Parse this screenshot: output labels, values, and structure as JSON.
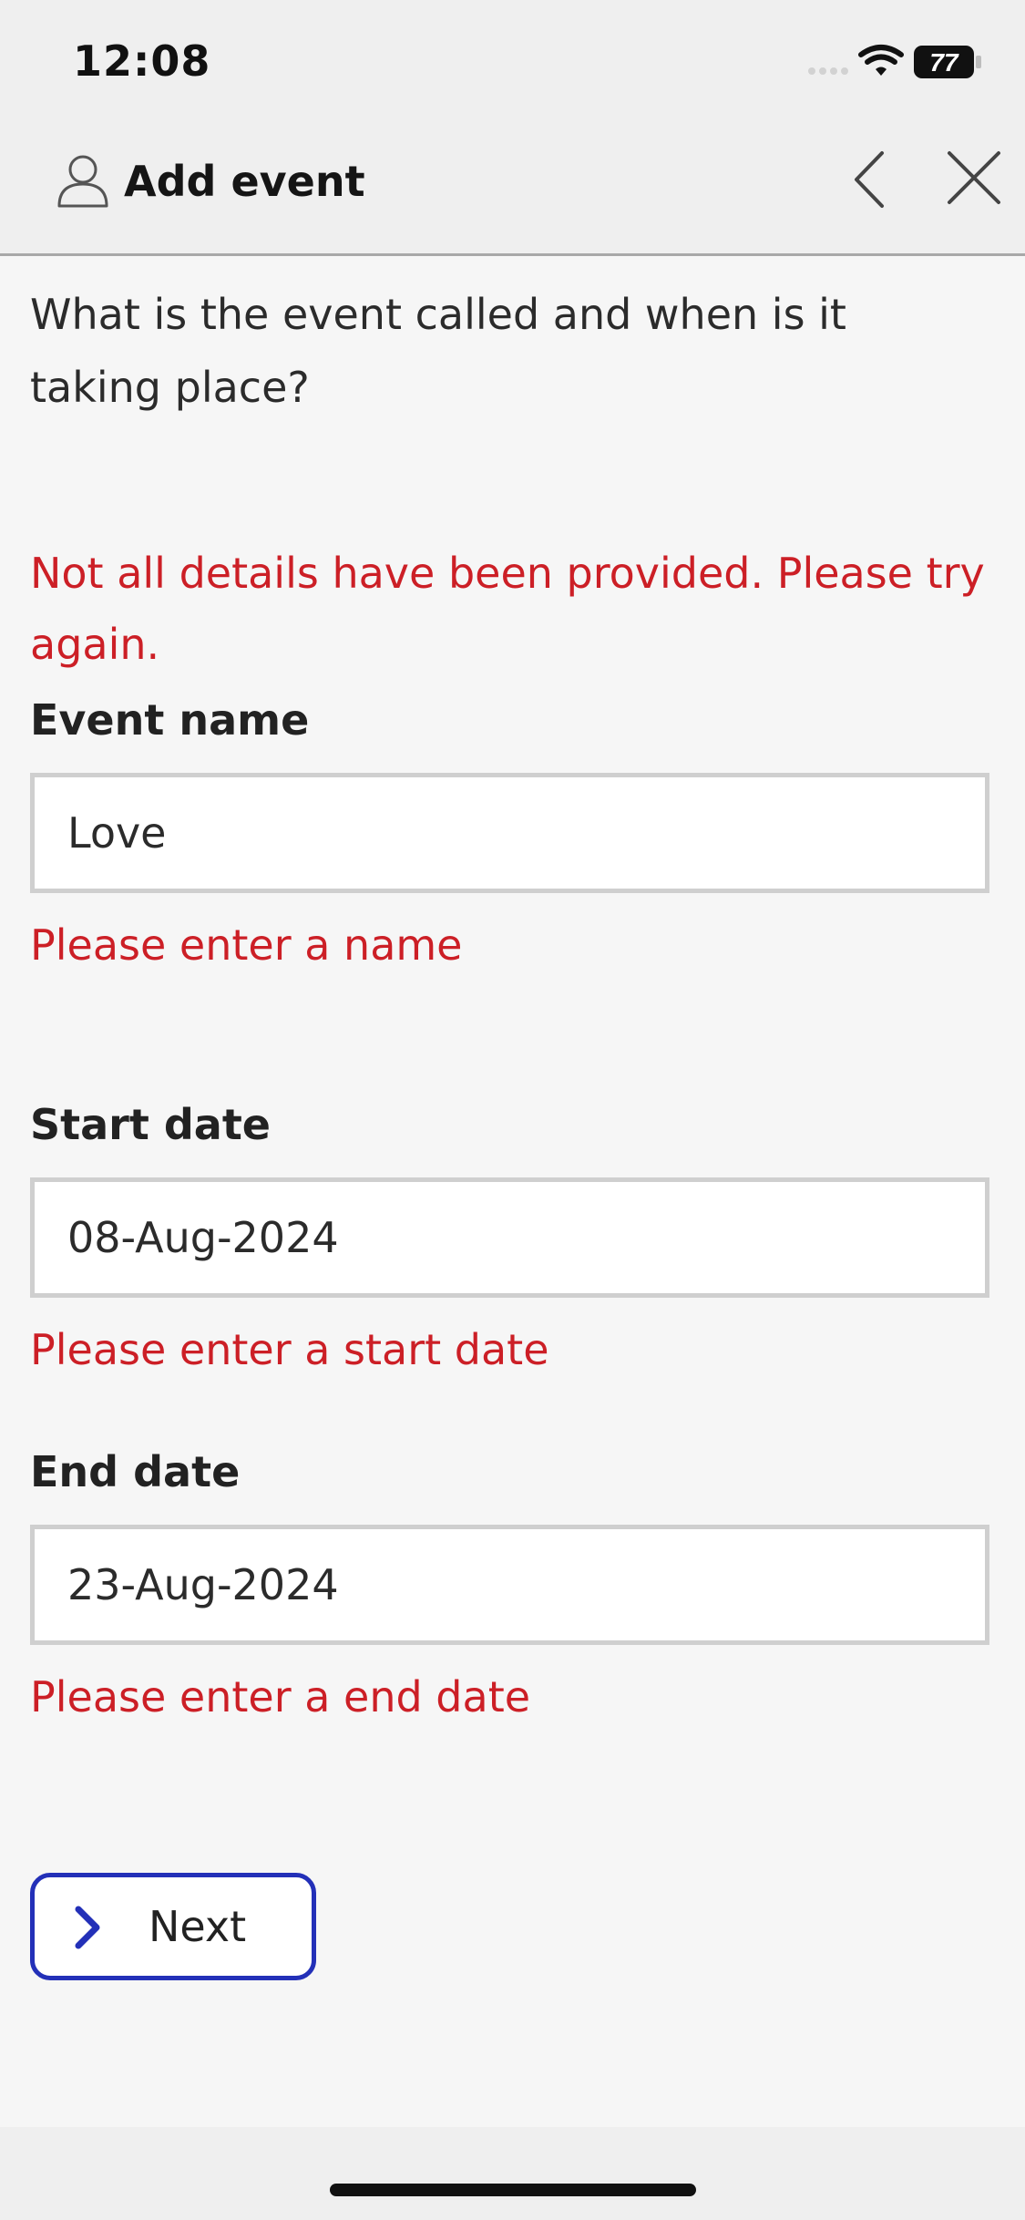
{
  "status_bar": {
    "time": "12:08",
    "battery": "77"
  },
  "header": {
    "title": "Add event"
  },
  "question": "What is the event called and when is it taking place?",
  "form_error": "Not all details have been provided. Please try again.",
  "fields": [
    {
      "label": "Event name",
      "value": "Love",
      "error": "Please enter a name"
    },
    {
      "label": "Start date",
      "value": "08-Aug-2024",
      "error": "Please enter a start date"
    },
    {
      "label": "End date",
      "value": "23-Aug-2024",
      "error": "Please enter a end date"
    }
  ],
  "next_button": {
    "label": "Next"
  },
  "colors": {
    "error": "#cc1f26",
    "accent": "#2330b8",
    "background": "#f6f6f6"
  }
}
